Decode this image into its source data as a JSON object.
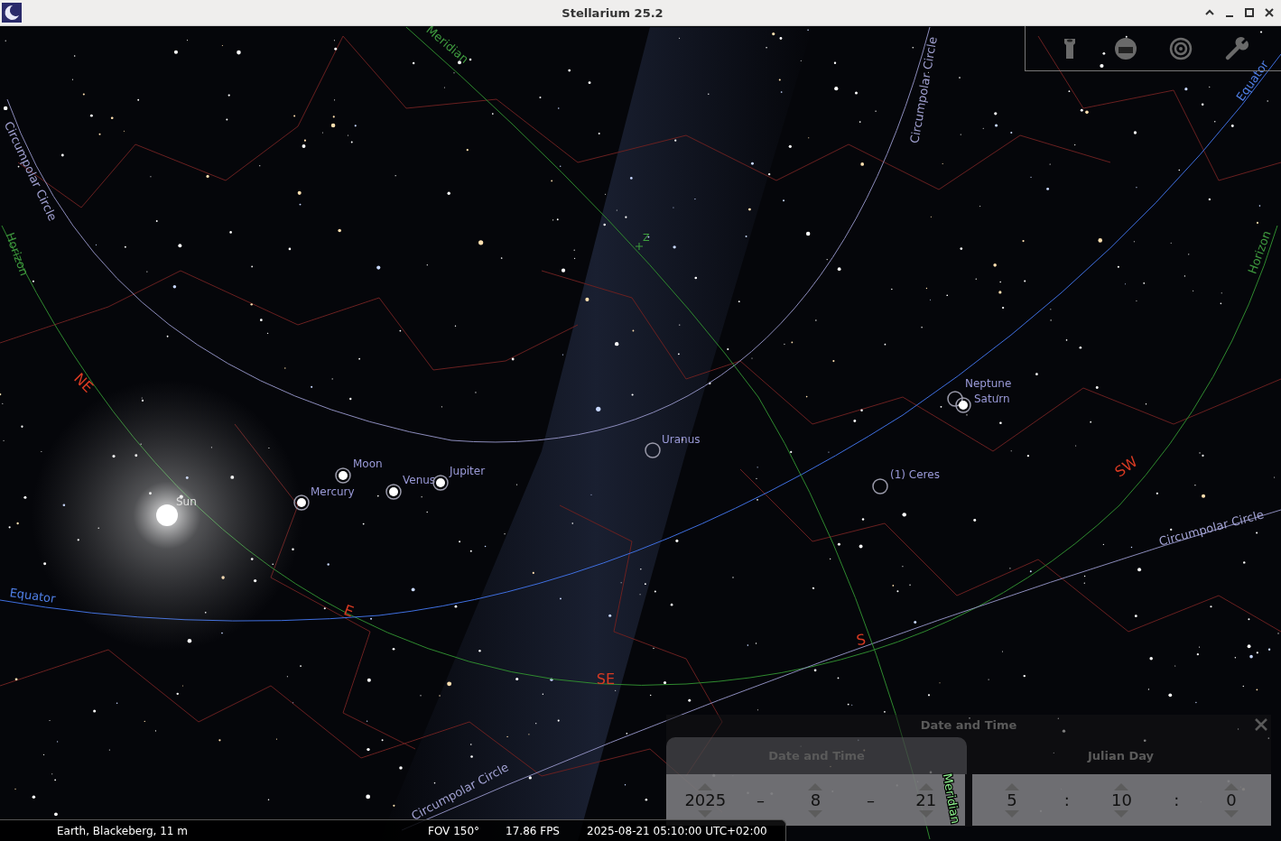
{
  "window": {
    "title": "Stellarium 25.2"
  },
  "sky": {
    "guide_labels": [
      {
        "text": "Meridian",
        "kind": "meridian"
      },
      {
        "text": "Circumpolar Circle",
        "kind": "circumpolar"
      },
      {
        "text": "Circumpolar Circle",
        "kind": "circumpolar"
      },
      {
        "text": "Horizon",
        "kind": "horizon"
      },
      {
        "text": "Horizon",
        "kind": "horizon"
      },
      {
        "text": "Equator",
        "kind": "equator"
      },
      {
        "text": "Equator",
        "kind": "equator"
      },
      {
        "text": "Circumpolar Circle",
        "kind": "circumpolar"
      },
      {
        "text": "Circumpolar Circle",
        "kind": "circumpolar"
      },
      {
        "text": "Meridian",
        "kind": "meridian"
      }
    ],
    "cardinals": [
      "NE",
      "E",
      "SE",
      "S",
      "SW"
    ],
    "zenith": "Z",
    "bodies": [
      {
        "name": "Sun",
        "kind": "sun"
      },
      {
        "name": "Moon",
        "kind": "planet"
      },
      {
        "name": "Mercury",
        "kind": "planet"
      },
      {
        "name": "Venus",
        "kind": "planet"
      },
      {
        "name": "Jupiter",
        "kind": "planet"
      },
      {
        "name": "Uranus",
        "kind": "minor"
      },
      {
        "name": "Neptune",
        "kind": "minor"
      },
      {
        "name": "Saturn",
        "kind": "planet"
      },
      {
        "name": "(1) Ceres",
        "kind": "minor"
      }
    ]
  },
  "date_time_dialog": {
    "title": "Date and Time",
    "tabs": [
      {
        "label": "Date and Time",
        "selected": true
      },
      {
        "label": "Julian Day",
        "selected": false
      }
    ],
    "date_fields": [
      "2025",
      "8",
      "21"
    ],
    "date_separator": "–",
    "time_fields": [
      "5",
      "10",
      "0"
    ],
    "time_separator": ":"
  },
  "status_bar": {
    "location": "Earth, Blackeberg, 11 m",
    "fov": "FOV 150°",
    "fps": "17.86 FPS",
    "datetime": "2025-08-21 05:10:00 UTC+02:00"
  }
}
